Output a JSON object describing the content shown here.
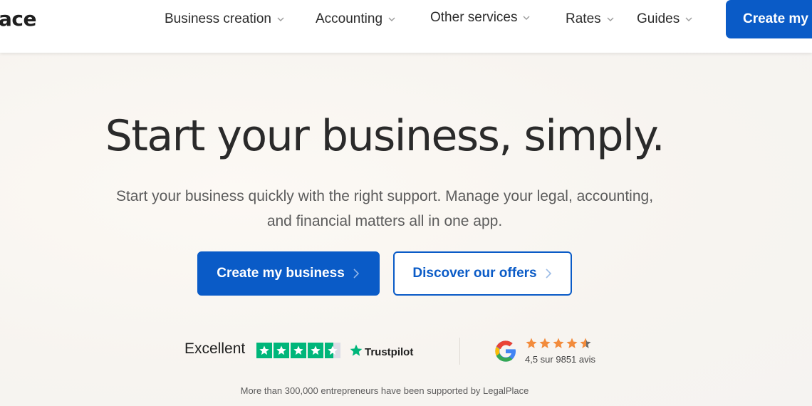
{
  "header": {
    "logo": "ace",
    "nav": [
      {
        "label": "Business creation"
      },
      {
        "label": "Accounting"
      },
      {
        "label": "Other services"
      },
      {
        "label": "Rates"
      },
      {
        "label": "Guides"
      }
    ],
    "cta_label": "Create my"
  },
  "hero": {
    "headline": "Start your business, simply.",
    "subtitle_line1": "Start your business quickly with the right support. Manage your legal, accounting,",
    "subtitle_line2": "and financial matters all in one app.",
    "primary_button": "Create my business",
    "secondary_button": "Discover our offers"
  },
  "ratings": {
    "trustpilot": {
      "rating_word": "Excellent",
      "brand": "Trustpilot",
      "stars": 4.5
    },
    "google": {
      "text": "4,5 sur 9851 avis",
      "stars": 4.5
    }
  },
  "footnote": "More than 300,000 entrepreneurs have been supported by LegalPlace",
  "colors": {
    "brand_blue": "#0a5bc7",
    "trustpilot_green": "#00b67a",
    "google_star": "#f28b3c",
    "background": "#f7f4f0"
  }
}
